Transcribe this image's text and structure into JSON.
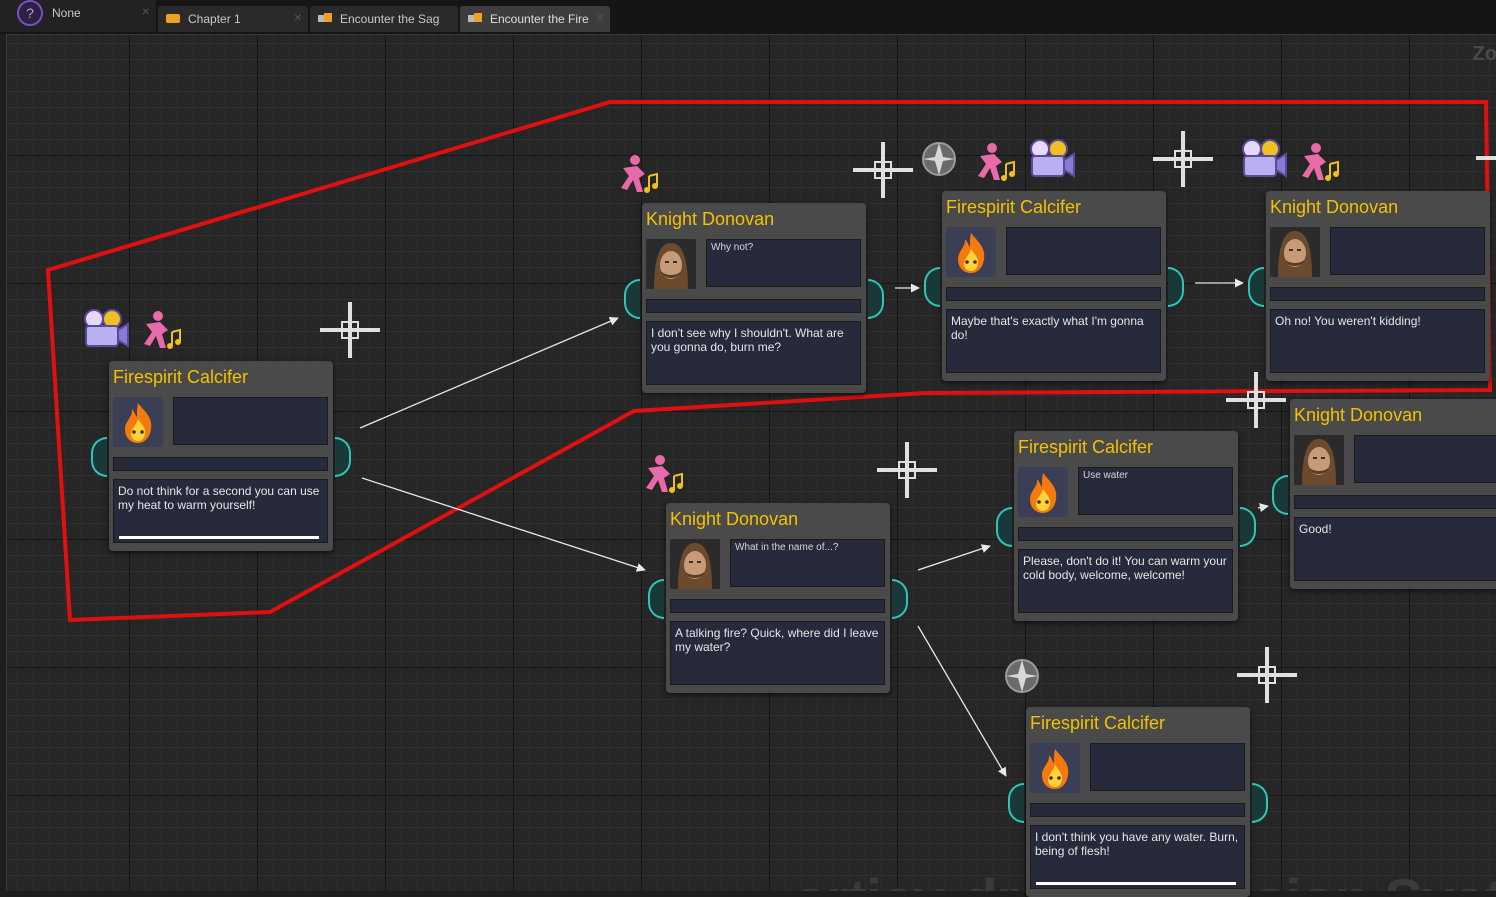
{
  "tabs": [
    {
      "label": "None",
      "active": false
    },
    {
      "label": "Chapter 1",
      "active": false
    },
    {
      "label": "Encounter the Sag",
      "active": false
    },
    {
      "label": "Encounter the Fire",
      "active": true
    }
  ],
  "canvas": {
    "zoom_label": "Zo",
    "watermark": "articy:draft Extension Syste"
  },
  "nodes": [
    {
      "speaker": "Firespirit Calcifer",
      "preview": "",
      "text": "Do not think for a second you can use my heat to warm yourself!",
      "progress": 1.0
    },
    {
      "speaker": "Knight Donovan",
      "preview": "Why not?",
      "text": "I don't see why I shouldn't. What are you gonna do, burn me?"
    },
    {
      "speaker": "Firespirit Calcifer",
      "preview": "",
      "text": "Maybe that's exactly what I'm gonna do!"
    },
    {
      "speaker": "Knight Donovan",
      "preview": "",
      "text": "Oh no! You weren't kidding!"
    },
    {
      "speaker": "Knight Donovan",
      "preview": "What in the name of...?",
      "text": "A talking fire? Quick, where did I leave my water?"
    },
    {
      "speaker": "Firespirit Calcifer",
      "preview": "Use water",
      "text": "Please, don't do it! You can warm your cold body, welcome, welcome!"
    },
    {
      "speaker": "Knight Donovan",
      "preview": "",
      "text": "Good!"
    },
    {
      "speaker": "Firespirit Calcifer",
      "preview": "",
      "text": "I don't think you have any water. Burn, being of flesh!",
      "progress": 1.0
    }
  ],
  "colors": {
    "speaker": "#f2c200",
    "pin": "#2ec4b6",
    "selection_outline": "#e01010",
    "wire": "#e8e8e8",
    "accent_purple": "#7a4cc7"
  },
  "icons": [
    "help-icon",
    "chapter-icon",
    "flow-icon",
    "camera-icon",
    "dance-icon",
    "crosshair-icon",
    "compass-icon"
  ]
}
